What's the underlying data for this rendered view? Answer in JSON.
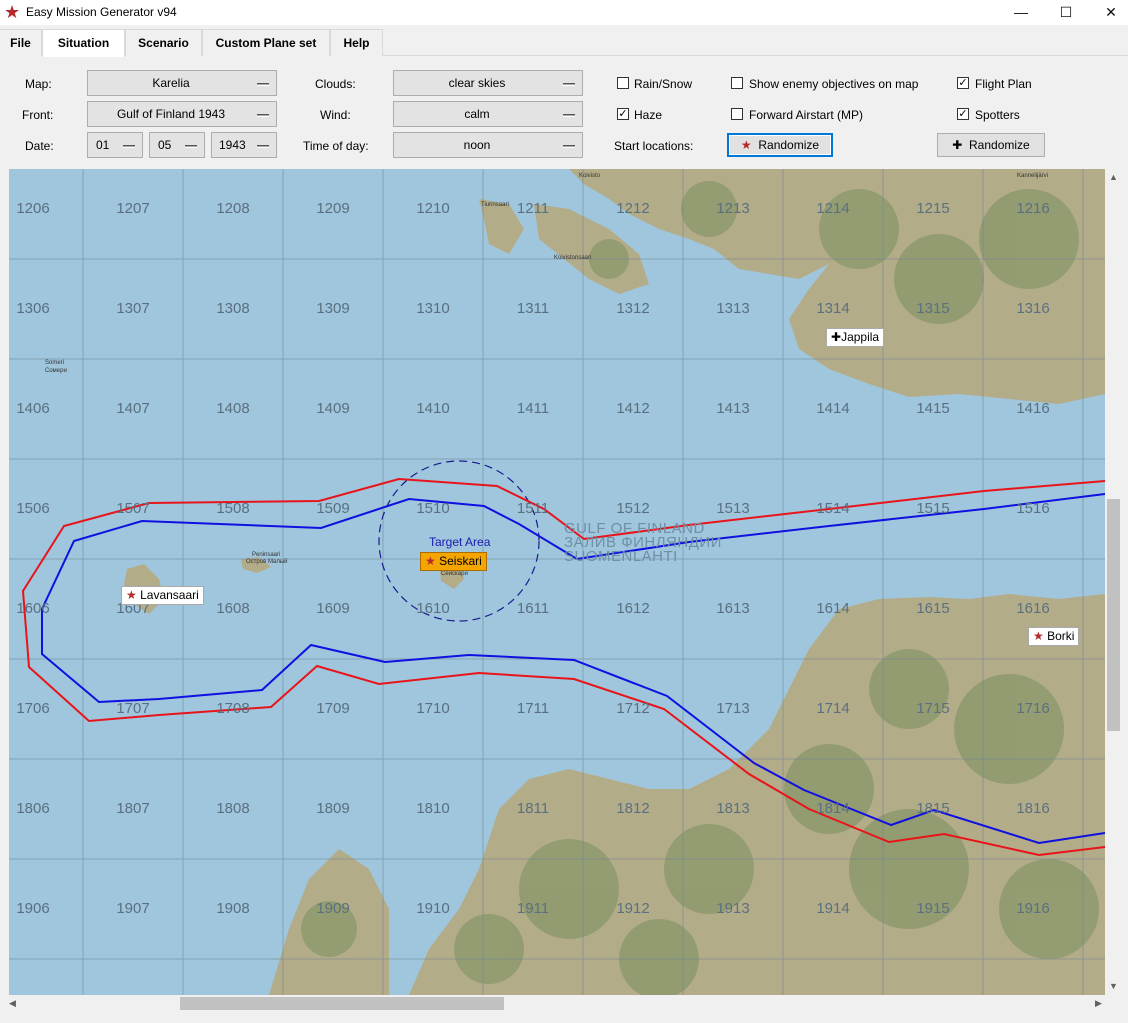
{
  "window": {
    "title": "Easy Mission Generator v94",
    "controls": {
      "minimize": "—",
      "maximize": "☐",
      "close": "✕"
    }
  },
  "menu": {
    "tabs": [
      {
        "label": "File",
        "active": false
      },
      {
        "label": "Situation",
        "active": true
      },
      {
        "label": "Scenario",
        "active": false
      },
      {
        "label": "Custom Plane set",
        "active": false
      },
      {
        "label": "Help",
        "active": false
      }
    ]
  },
  "form": {
    "map_label": "Map:",
    "map_value": "Karelia",
    "front_label": "Front:",
    "front_value": "Gulf of Finland 1943",
    "date_label": "Date:",
    "date_day": "01",
    "date_month": "05",
    "date_year": "1943",
    "clouds_label": "Clouds:",
    "clouds_value": "clear skies",
    "wind_label": "Wind:",
    "wind_value": "calm",
    "time_label": "Time of day:",
    "time_value": "noon",
    "rain_label": "Rain/Snow",
    "rain_checked": false,
    "haze_label": "Haze",
    "haze_checked": true,
    "start_locations_label": "Start locations:",
    "randomize_start_label": "Randomize",
    "show_enemy_label": "Show enemy objectives on map",
    "show_enemy_checked": false,
    "forward_airstart_label": "Forward Airstart (MP)",
    "forward_airstart_checked": false,
    "flight_plan_label": "Flight Plan",
    "flight_plan_checked": true,
    "spotters_label": "Spotters",
    "spotters_checked": true,
    "randomize_label": "Randomize",
    "check_glyph": "✓",
    "star_glyph": "★",
    "cross_glyph": "✚"
  },
  "map": {
    "grid_rows": [
      [
        "1206",
        "1207",
        "1208",
        "1209",
        "1210",
        "1211",
        "1212",
        "1213",
        "1214",
        "1215",
        "1216"
      ],
      [
        "1306",
        "1307",
        "1308",
        "1309",
        "1310",
        "1311",
        "1312",
        "1313",
        "1314",
        "1315",
        "1316"
      ],
      [
        "1406",
        "1407",
        "1408",
        "1409",
        "1410",
        "1411",
        "1412",
        "1413",
        "1414",
        "1415",
        "1416"
      ],
      [
        "1506",
        "1507",
        "1508",
        "1509",
        "1510",
        "1511",
        "1512",
        "1513",
        "1514",
        "1515",
        "1516"
      ],
      [
        "1606",
        "1607",
        "1608",
        "1609",
        "1610",
        "1611",
        "1612",
        "1613",
        "1614",
        "1615",
        "1616"
      ],
      [
        "1706",
        "1707",
        "1708",
        "1709",
        "1710",
        "1711",
        "1712",
        "1713",
        "1714",
        "1715",
        "1716"
      ],
      [
        "1806",
        "1807",
        "1808",
        "1809",
        "1810",
        "1811",
        "1812",
        "1813",
        "1814",
        "1815",
        "1816"
      ],
      [
        "1906",
        "1907",
        "1908",
        "1909",
        "1910",
        "1911",
        "1912",
        "1913",
        "1914",
        "1915",
        "1916"
      ]
    ],
    "sea_label": [
      "GULF OF FINLAND",
      "ЗАЛИВ ФИНЛЯНДИИ",
      "SUOMENLAHTI"
    ],
    "target_area_label": "Target Area",
    "target_name": "Seiskari",
    "airfields": [
      {
        "name": "Jappila",
        "side": "allied"
      },
      {
        "name": "Lavansaari",
        "side": "soviet"
      },
      {
        "name": "Borki",
        "side": "soviet"
      }
    ],
    "towns": [
      "Koivisto",
      "Tiurinsaari",
      "Koivistonsaari",
      "Someri",
      "Сомери",
      "Peninsaari",
      "Остров Малый",
      "Сейскари",
      "Kannelijärvi"
    ],
    "colors": {
      "sea": "#9fc6dc",
      "land": "#b7ae8a",
      "forest": "#8f9b6f",
      "route_red": "#e8141a",
      "route_blue": "#1010e0"
    }
  },
  "scroll": {
    "up": "▲",
    "down": "▼",
    "left": "◀",
    "right": "▶"
  }
}
